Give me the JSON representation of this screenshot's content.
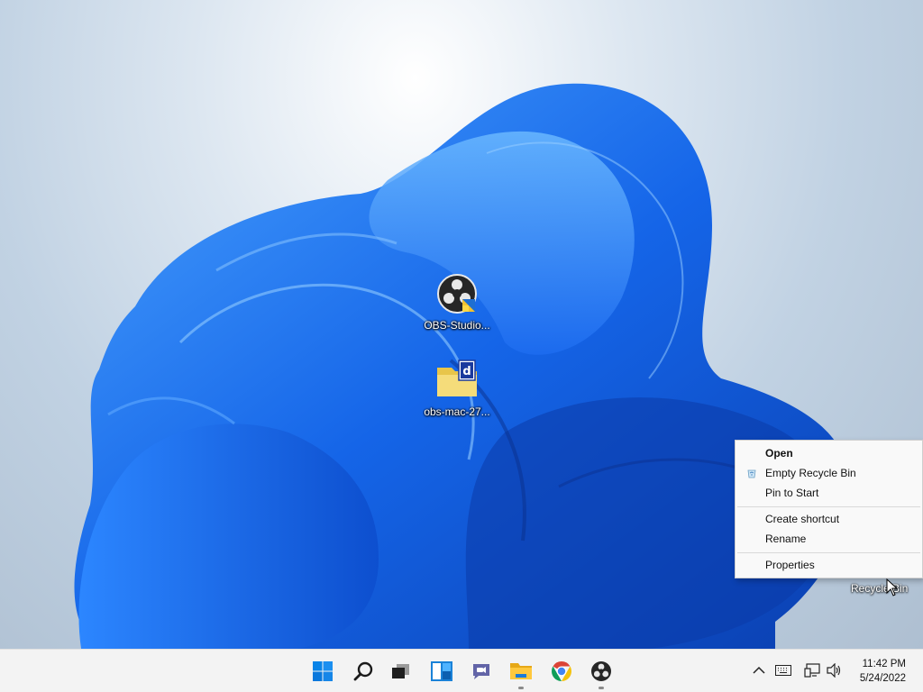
{
  "desktop": {
    "icons": [
      {
        "label": "OBS-Studio...",
        "icon": "obs-studio-icon"
      },
      {
        "label": "obs-mac-27...",
        "icon": "zip-folder-icon"
      }
    ],
    "recycle_bin_label": "Recycle Bin"
  },
  "context_menu": {
    "items": [
      {
        "label": "Open",
        "bold": true
      },
      {
        "label": "Empty Recycle Bin",
        "icon": "recycle-bin-small-icon"
      },
      {
        "label": "Pin to Start"
      },
      {
        "label": "Create shortcut"
      },
      {
        "label": "Rename"
      },
      {
        "label": "Properties"
      }
    ]
  },
  "taskbar": {
    "apps": [
      "start-icon",
      "search-icon",
      "task-view-icon",
      "widgets-icon",
      "chat-icon",
      "file-explorer-icon",
      "chrome-icon",
      "obs-icon"
    ],
    "tray": [
      "chevron-up-icon",
      "keyboard-icon",
      "network-icon",
      "volume-icon"
    ],
    "clock": {
      "time": "11:42 PM",
      "date": "5/24/2022"
    }
  },
  "colors": {
    "accent": "#0078d4",
    "wallpaper_blue": "#1a6df0",
    "taskbar": "#f3f3f3"
  }
}
